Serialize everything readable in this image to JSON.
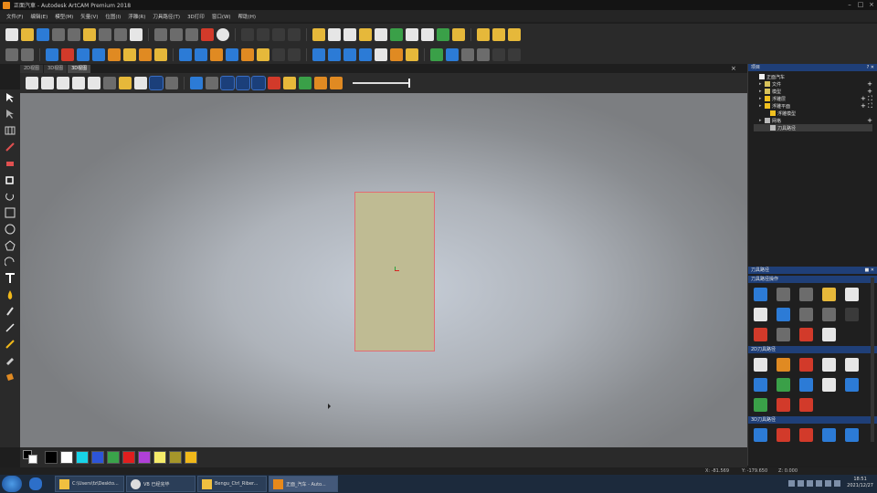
{
  "window": {
    "title": "正面汽車 - Autodesk ArtCAM Premium 2018"
  },
  "menu": [
    "文件(F)",
    "编辑(E)",
    "模型(M)",
    "矢量(V)",
    "位图(I)",
    "浮雕(R)",
    "刀具路径(T)",
    "3D打印",
    "窗口(W)",
    "帮助(H)"
  ],
  "view_tabs": [
    {
      "label": "2D视图",
      "active": false
    },
    {
      "label": "3D视图",
      "active": false
    },
    {
      "label": "3D视图",
      "active": true
    }
  ],
  "palette": {
    "colors": [
      "#000000",
      "#ffffff",
      "#18d4e8",
      "#2d55d8",
      "#3aa34a",
      "#e01e1e",
      "#b040d8",
      "#f5ec6a",
      "#a6962a",
      "#f0b81a"
    ]
  },
  "project": {
    "title": "项目",
    "tree": [
      {
        "label": "正面汽车",
        "icon": "document-icon",
        "level": 0,
        "right": ""
      },
      {
        "label": "文件",
        "icon": "layer-icon",
        "level": 1,
        "right": "+"
      },
      {
        "label": "模型",
        "icon": "layer-icon",
        "level": 1,
        "right": "+"
      },
      {
        "label": "浮雕层",
        "icon": "star-icon",
        "level": 1,
        "right": "+ ⛶"
      },
      {
        "label": "浮雕平面",
        "icon": "star-icon",
        "level": 1,
        "right": "+ ⛶"
      },
      {
        "label": "浮雕模型",
        "icon": "star-icon",
        "level": 2,
        "right": ""
      },
      {
        "label": "网格",
        "icon": "grid-icon",
        "level": 1,
        "right": "+"
      },
      {
        "label": "刀具路径",
        "icon": "toolpath-icon",
        "level": 2,
        "right": ""
      }
    ]
  },
  "toolpaths": {
    "title": "刀具路径",
    "sections": [
      "刀具路径操作",
      "2D刀具路径",
      "3D刀具路径"
    ]
  },
  "status": {
    "x": "X: -81.569",
    "y": "Y: -179.650",
    "z": "Z: 0.000"
  },
  "taskbar": {
    "tasks": [
      {
        "label": "C:\\Users\\fz\\Deskto...",
        "icon": "folder-icon"
      },
      {
        "label": "VB 已经完毕",
        "icon": "app-icon"
      },
      {
        "label": "Bengu_Ctrl_Riber...",
        "icon": "folder-icon"
      },
      {
        "label": "正面_汽车 - Auto...",
        "icon": "artcam-icon"
      }
    ],
    "time": "18:51",
    "date": "2021/12/27"
  }
}
